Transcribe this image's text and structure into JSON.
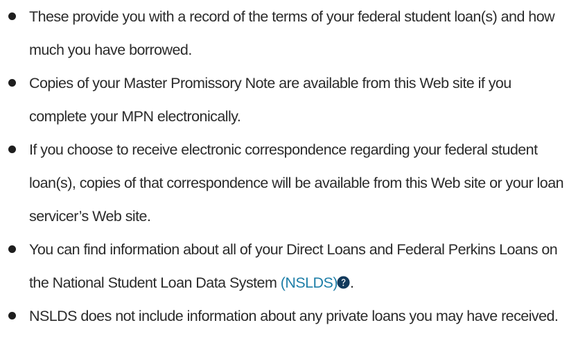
{
  "bullets": [
    {
      "text": "These provide you with a record of the terms of your federal student loan(s) and how much you have borrowed."
    },
    {
      "text": "Copies of your Master Promissory Note are available from this Web site if you complete your MPN electronically."
    },
    {
      "text": "If you choose to receive electronic correspondence regarding your federal student loan(s), copies of that correspondence will be available from this Web site or your loan servicer’s Web site."
    },
    {
      "text_before": "You can find information about all of your Direct Loans and Federal Perkins Loans on the National Student Loan Data System ",
      "link": "(NSLDS)",
      "text_after": "."
    },
    {
      "text": "NSLDS does not include information about any private loans you may have received."
    }
  ],
  "icons": {
    "help": "question-circle-icon"
  },
  "colors": {
    "text": "#2b2b2b",
    "bullet": "#1e1e1e",
    "link": "#1f7fa8",
    "icon": "#123a5c",
    "background": "#ffffff"
  }
}
